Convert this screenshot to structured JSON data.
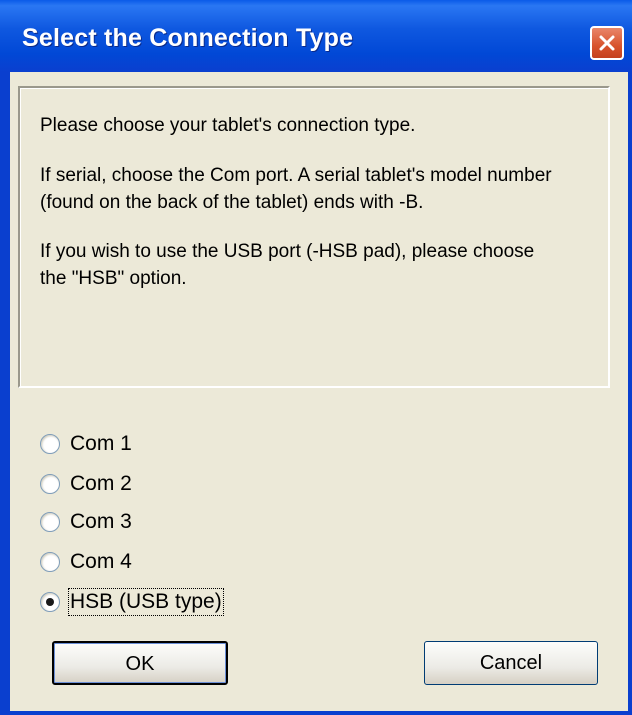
{
  "window": {
    "title": "Select the Connection Type"
  },
  "instructions": {
    "line1": "Please choose your tablet's connection type.",
    "line2a": "If serial, choose the Com port. A serial tablet's model number",
    "line2b": "(found on the back of the tablet) ends with -B.",
    "line3a": "If you wish to use the USB port (-HSB pad), please choose",
    "line3b": "the \"HSB\" option."
  },
  "options": [
    {
      "label": "Com 1",
      "selected": false
    },
    {
      "label": "Com 2",
      "selected": false
    },
    {
      "label": "Com 3",
      "selected": false
    },
    {
      "label": "Com 4",
      "selected": false
    },
    {
      "label": "HSB (USB type)",
      "selected": true
    }
  ],
  "buttons": {
    "ok": "OK",
    "cancel": "Cancel"
  },
  "colors": {
    "titlebar": "#0148d6",
    "dialog_bg": "#ece9d8",
    "close_button": "#d8532c"
  }
}
